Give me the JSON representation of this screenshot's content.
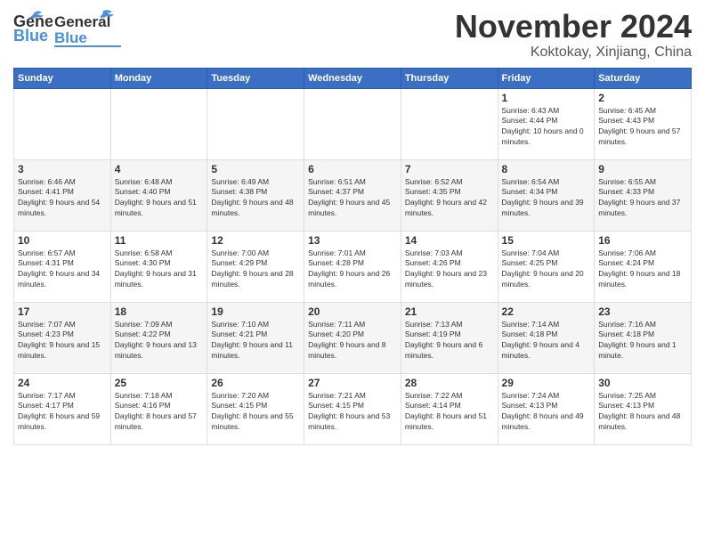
{
  "header": {
    "logo_text_general": "General",
    "logo_text_blue": "Blue",
    "month_title": "November 2024",
    "subtitle": "Koktokay, Xinjiang, China"
  },
  "days_of_week": [
    "Sunday",
    "Monday",
    "Tuesday",
    "Wednesday",
    "Thursday",
    "Friday",
    "Saturday"
  ],
  "weeks": [
    [
      {
        "day": "",
        "info": ""
      },
      {
        "day": "",
        "info": ""
      },
      {
        "day": "",
        "info": ""
      },
      {
        "day": "",
        "info": ""
      },
      {
        "day": "",
        "info": ""
      },
      {
        "day": "1",
        "info": "Sunrise: 6:43 AM\nSunset: 4:44 PM\nDaylight: 10 hours and 0 minutes."
      },
      {
        "day": "2",
        "info": "Sunrise: 6:45 AM\nSunset: 4:43 PM\nDaylight: 9 hours and 57 minutes."
      }
    ],
    [
      {
        "day": "3",
        "info": "Sunrise: 6:46 AM\nSunset: 4:41 PM\nDaylight: 9 hours and 54 minutes."
      },
      {
        "day": "4",
        "info": "Sunrise: 6:48 AM\nSunset: 4:40 PM\nDaylight: 9 hours and 51 minutes."
      },
      {
        "day": "5",
        "info": "Sunrise: 6:49 AM\nSunset: 4:38 PM\nDaylight: 9 hours and 48 minutes."
      },
      {
        "day": "6",
        "info": "Sunrise: 6:51 AM\nSunset: 4:37 PM\nDaylight: 9 hours and 45 minutes."
      },
      {
        "day": "7",
        "info": "Sunrise: 6:52 AM\nSunset: 4:35 PM\nDaylight: 9 hours and 42 minutes."
      },
      {
        "day": "8",
        "info": "Sunrise: 6:54 AM\nSunset: 4:34 PM\nDaylight: 9 hours and 39 minutes."
      },
      {
        "day": "9",
        "info": "Sunrise: 6:55 AM\nSunset: 4:33 PM\nDaylight: 9 hours and 37 minutes."
      }
    ],
    [
      {
        "day": "10",
        "info": "Sunrise: 6:57 AM\nSunset: 4:31 PM\nDaylight: 9 hours and 34 minutes."
      },
      {
        "day": "11",
        "info": "Sunrise: 6:58 AM\nSunset: 4:30 PM\nDaylight: 9 hours and 31 minutes."
      },
      {
        "day": "12",
        "info": "Sunrise: 7:00 AM\nSunset: 4:29 PM\nDaylight: 9 hours and 28 minutes."
      },
      {
        "day": "13",
        "info": "Sunrise: 7:01 AM\nSunset: 4:28 PM\nDaylight: 9 hours and 26 minutes."
      },
      {
        "day": "14",
        "info": "Sunrise: 7:03 AM\nSunset: 4:26 PM\nDaylight: 9 hours and 23 minutes."
      },
      {
        "day": "15",
        "info": "Sunrise: 7:04 AM\nSunset: 4:25 PM\nDaylight: 9 hours and 20 minutes."
      },
      {
        "day": "16",
        "info": "Sunrise: 7:06 AM\nSunset: 4:24 PM\nDaylight: 9 hours and 18 minutes."
      }
    ],
    [
      {
        "day": "17",
        "info": "Sunrise: 7:07 AM\nSunset: 4:23 PM\nDaylight: 9 hours and 15 minutes."
      },
      {
        "day": "18",
        "info": "Sunrise: 7:09 AM\nSunset: 4:22 PM\nDaylight: 9 hours and 13 minutes."
      },
      {
        "day": "19",
        "info": "Sunrise: 7:10 AM\nSunset: 4:21 PM\nDaylight: 9 hours and 11 minutes."
      },
      {
        "day": "20",
        "info": "Sunrise: 7:11 AM\nSunset: 4:20 PM\nDaylight: 9 hours and 8 minutes."
      },
      {
        "day": "21",
        "info": "Sunrise: 7:13 AM\nSunset: 4:19 PM\nDaylight: 9 hours and 6 minutes."
      },
      {
        "day": "22",
        "info": "Sunrise: 7:14 AM\nSunset: 4:18 PM\nDaylight: 9 hours and 4 minutes."
      },
      {
        "day": "23",
        "info": "Sunrise: 7:16 AM\nSunset: 4:18 PM\nDaylight: 9 hours and 1 minute."
      }
    ],
    [
      {
        "day": "24",
        "info": "Sunrise: 7:17 AM\nSunset: 4:17 PM\nDaylight: 8 hours and 59 minutes."
      },
      {
        "day": "25",
        "info": "Sunrise: 7:18 AM\nSunset: 4:16 PM\nDaylight: 8 hours and 57 minutes."
      },
      {
        "day": "26",
        "info": "Sunrise: 7:20 AM\nSunset: 4:15 PM\nDaylight: 8 hours and 55 minutes."
      },
      {
        "day": "27",
        "info": "Sunrise: 7:21 AM\nSunset: 4:15 PM\nDaylight: 8 hours and 53 minutes."
      },
      {
        "day": "28",
        "info": "Sunrise: 7:22 AM\nSunset: 4:14 PM\nDaylight: 8 hours and 51 minutes."
      },
      {
        "day": "29",
        "info": "Sunrise: 7:24 AM\nSunset: 4:13 PM\nDaylight: 8 hours and 49 minutes."
      },
      {
        "day": "30",
        "info": "Sunrise: 7:25 AM\nSunset: 4:13 PM\nDaylight: 8 hours and 48 minutes."
      }
    ]
  ]
}
